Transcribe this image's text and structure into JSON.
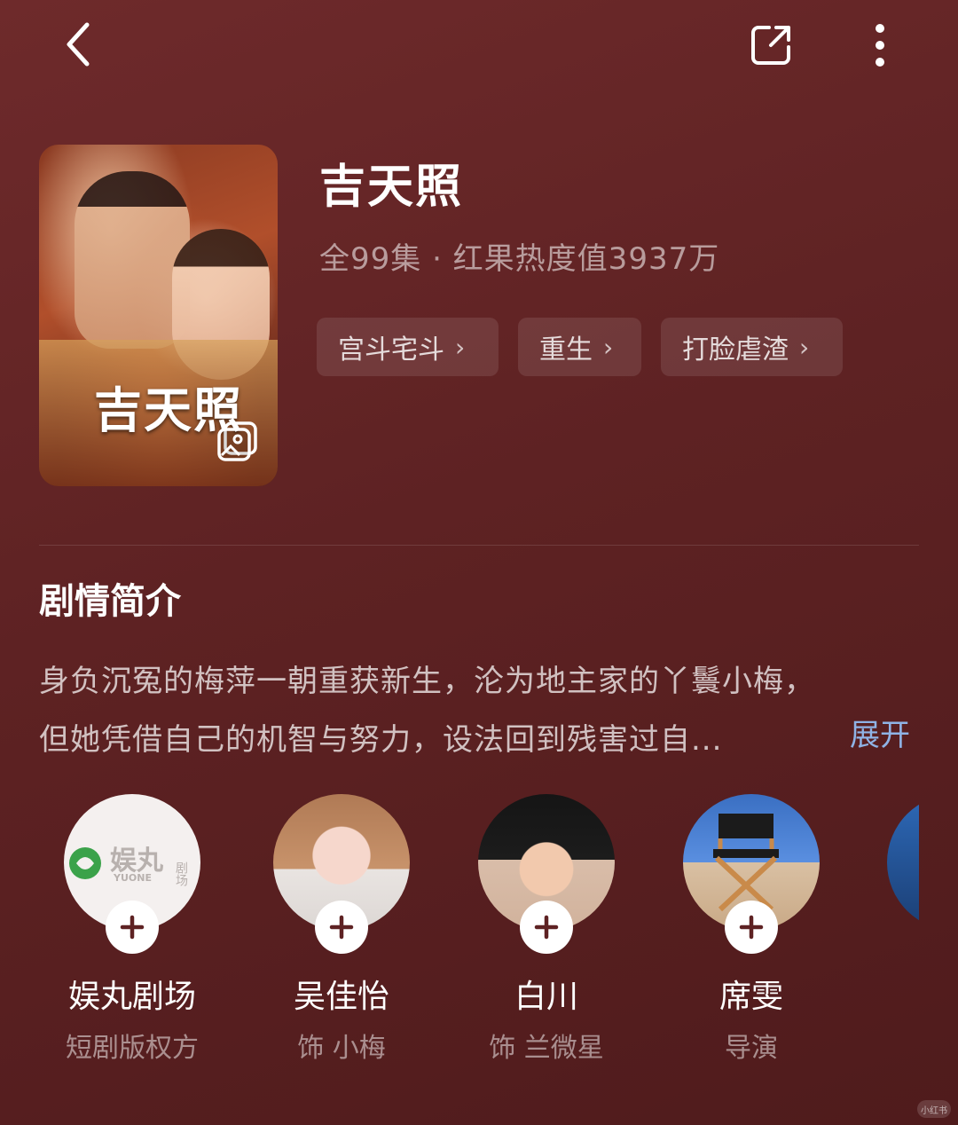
{
  "nav": {
    "back_icon": "chevron-left-icon",
    "share_icon": "share-icon",
    "more_icon": "more-vertical-icon"
  },
  "drama": {
    "poster_title": "吉天照",
    "title": "吉天照",
    "meta": "全99集 · 红果热度值3937万",
    "tags": [
      {
        "label": "宫斗宅斗"
      },
      {
        "label": "重生"
      },
      {
        "label": "打脸虐渣"
      }
    ]
  },
  "synopsis": {
    "heading": "剧情简介",
    "line1": "身负沉冤的梅萍一朝重获新生，沦为地主家的丫鬟小梅，",
    "line2": "但她凭借自己的机智与努力，设法回到残害过自...",
    "expand_label": "展开"
  },
  "people": [
    {
      "name": "娱丸剧场",
      "role": "短剧版权方",
      "logo_text": "娱丸",
      "logo_sub": "YUONE",
      "logo_side": "剧场"
    },
    {
      "name": "吴佳怡",
      "role": "饰 小梅"
    },
    {
      "name": "白川",
      "role": "饰 兰微星"
    },
    {
      "name": "席雯",
      "role": "导演"
    }
  ],
  "watermark": "小红书",
  "colors": {
    "background": "#5e2223",
    "accent_link": "#8fb3e6"
  }
}
